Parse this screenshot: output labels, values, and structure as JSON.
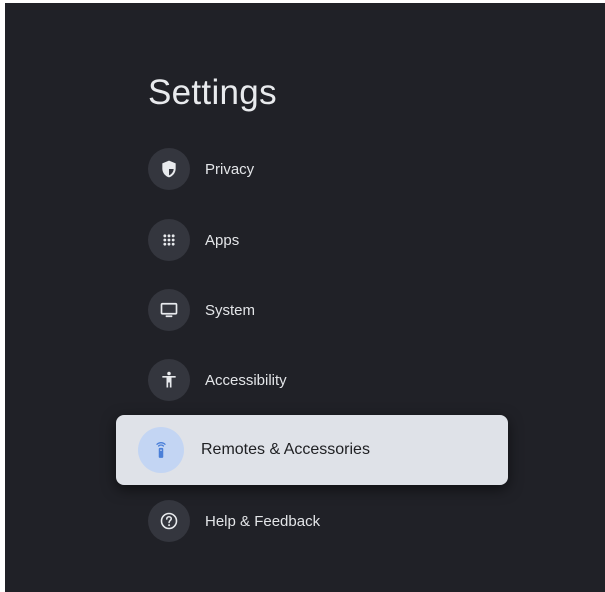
{
  "header": {
    "title": "Settings"
  },
  "menu": {
    "items": [
      {
        "label": "Privacy",
        "icon": "shield-icon",
        "selected": false
      },
      {
        "label": "Apps",
        "icon": "apps-grid-icon",
        "selected": false
      },
      {
        "label": "System",
        "icon": "monitor-icon",
        "selected": false
      },
      {
        "label": "Accessibility",
        "icon": "accessibility-icon",
        "selected": false
      },
      {
        "label": "Remotes & Accessories",
        "icon": "remote-icon",
        "selected": true
      },
      {
        "label": "Help & Feedback",
        "icon": "help-icon",
        "selected": false
      }
    ]
  },
  "colors": {
    "background": "#202127",
    "icon_circle": "#34363e",
    "selected_background": "#dfe2e8",
    "selected_icon_circle": "#c3d5f3",
    "accent": "#4a7fd8"
  }
}
